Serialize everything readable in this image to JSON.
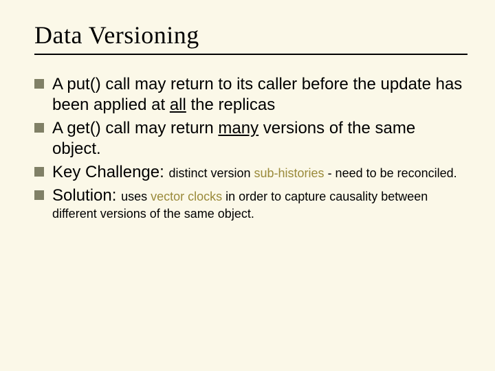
{
  "title": "Data Versioning",
  "items": [
    {
      "pre1": "A put() call may return to its caller before the update has been applied at ",
      "u1": "all",
      "post1": " the replicas"
    },
    {
      "pre1": "A get() call may return ",
      "u1": "many",
      "post1": " versions of the same object."
    },
    {
      "label": "Key Challenge: ",
      "sub_pre": "distinct version ",
      "sub_acc": "sub-histories",
      "sub_post": " - need to be reconciled."
    },
    {
      "label": "Solution: ",
      "sub_pre": "uses ",
      "sub_acc": "vector clocks",
      "sub_post": " in order to capture causality between different versions of the same object."
    }
  ]
}
